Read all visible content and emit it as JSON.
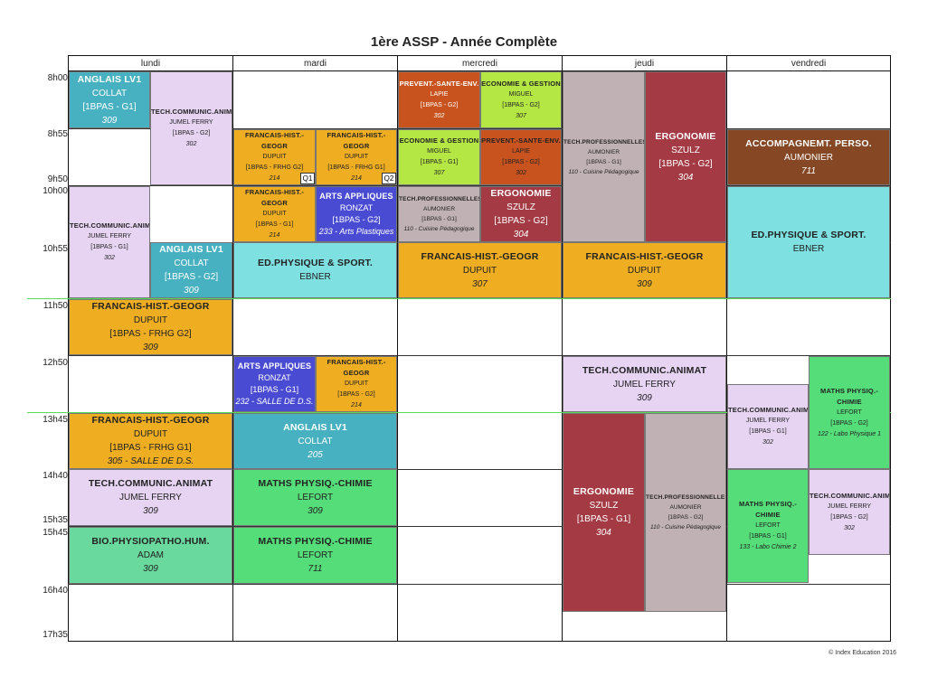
{
  "title": "1ère ASSP - Année Complète",
  "footer": "© Index Education 2016",
  "days": [
    "lundi",
    "mardi",
    "mercredi",
    "jeudi",
    "vendredi"
  ],
  "times": [
    "8h00",
    "8h55",
    "9h50",
    "10h00",
    "10h55",
    "11h50",
    "12h50",
    "13h45",
    "14h40",
    "15h35",
    "15h45",
    "16h40",
    "17h35"
  ],
  "colors": {
    "anglais": "#48b1c1",
    "tech": "#e6d4f2",
    "francais": "#efad21",
    "prevent": "#c9531e",
    "eco": "#b5e744",
    "techpro": "#c0b1b4",
    "ergo": "#a33a44",
    "arts": "#4a4bd3",
    "edphys": "#7ee0e0",
    "accomp": "#854724",
    "maths": "#55dd7a",
    "bio": "#6ad99e"
  },
  "cells": {
    "c1": {
      "subject": "ANGLAIS LV1",
      "teacher": "COLLAT",
      "group": "[1BPAS - G1]",
      "room": "309"
    },
    "c2": {
      "subject": "TECH.COMMUNIC.ANIMAT",
      "teacher": "JUMEL FERRY",
      "group": "[1BPAS - G2]",
      "room": "302"
    },
    "c3": {
      "subject": "TECH.COMMUNIC.ANIMAT",
      "teacher": "JUMEL FERRY",
      "group": "[1BPAS - G1]",
      "room": "302"
    },
    "c4": {
      "subject": "ANGLAIS LV1",
      "teacher": "COLLAT",
      "group": "[1BPAS - G2]",
      "room": "309"
    },
    "c5": {
      "subject": "FRANCAIS-HIST.-GEOGR",
      "teacher": "DUPUIT",
      "group": "[1BPAS - FRHG G2]",
      "room": "309"
    },
    "c6": {
      "subject": "FRANCAIS-HIST.-GEOGR",
      "teacher": "DUPUIT",
      "group": "[1BPAS - FRHG G1]",
      "room": "305 - SALLE DE D.S."
    },
    "c7": {
      "subject": "TECH.COMMUNIC.ANIMAT",
      "teacher": "JUMEL FERRY",
      "room": "309"
    },
    "c8": {
      "subject": "BIO.PHYSIOPATHO.HUM.",
      "teacher": "ADAM",
      "room": "309"
    },
    "c9": {
      "subject": "FRANCAIS-HIST.-GEOGR",
      "teacher": "DUPUIT",
      "group": "[1BPAS - FRHG G2]",
      "room": "214",
      "tag": "Q1"
    },
    "c10": {
      "subject": "FRANCAIS-HIST.-GEOGR",
      "teacher": "DUPUIT",
      "group": "[1BPAS - FRHG G1]",
      "room": "214",
      "tag": "Q2"
    },
    "c11": {
      "subject": "FRANCAIS-HIST.-GEOGR",
      "teacher": "DUPUIT",
      "group": "[1BPAS - G1]",
      "room": "214"
    },
    "c12": {
      "subject": "ARTS APPLIQUES",
      "teacher": "RONZAT",
      "group": "[1BPAS - G2]",
      "room": "233 - Arts Plastiques"
    },
    "c13": {
      "subject": "ED.PHYSIQUE & SPORT.",
      "teacher": "EBNER"
    },
    "c14": {
      "subject": "ARTS APPLIQUES",
      "teacher": "RONZAT",
      "group": "[1BPAS - G1]",
      "room": "232 - SALLE DE D.S."
    },
    "c15": {
      "subject": "FRANCAIS-HIST.-GEOGR",
      "teacher": "DUPUIT",
      "group": "[1BPAS - G2]",
      "room": "214"
    },
    "c16": {
      "subject": "ANGLAIS LV1",
      "teacher": "COLLAT",
      "room": "205"
    },
    "c17": {
      "subject": "MATHS PHYSIQ.-CHIMIE",
      "teacher": "LEFORT",
      "room": "309"
    },
    "c18": {
      "subject": "MATHS PHYSIQ.-CHIMIE",
      "teacher": "LEFORT",
      "room": "711"
    },
    "c19": {
      "subject": "PREVENT.-SANTE-ENV.",
      "teacher": "LAPIE",
      "group": "[1BPAS - G2]",
      "room": "302"
    },
    "c20": {
      "subject": "ECONOMIE & GESTION",
      "teacher": "MIGUEL",
      "group": "[1BPAS - G2]",
      "room": "307"
    },
    "c21": {
      "subject": "ECONOMIE & GESTION",
      "teacher": "MIGUEL",
      "group": "[1BPAS - G1]",
      "room": "307"
    },
    "c22": {
      "subject": "PREVENT.-SANTE-ENV.",
      "teacher": "LAPIE",
      "group": "[1BPAS - G2]",
      "room": "302"
    },
    "c23": {
      "subject": "TECH.PROFESSIONNELLES",
      "teacher": "AUMONIER",
      "group": "[1BPAS - G1]",
      "room": "110 - Cuisine Pédagogique"
    },
    "c24": {
      "subject": "ERGONOMIE",
      "teacher": "SZULZ",
      "group": "[1BPAS - G2]",
      "room": "304"
    },
    "c25": {
      "subject": "FRANCAIS-HIST.-GEOGR",
      "teacher": "DUPUIT",
      "room": "307"
    },
    "c26": {
      "subject": "TECH.PROFESSIONNELLES",
      "teacher": "AUMONIER",
      "group": "[1BPAS - G1]",
      "room": "110 - Cuisine Pédagogique"
    },
    "c27": {
      "subject": "ERGONOMIE",
      "teacher": "SZULZ",
      "group": "[1BPAS - G2]",
      "room": "304"
    },
    "c28": {
      "subject": "FRANCAIS-HIST.-GEOGR",
      "teacher": "DUPUIT",
      "room": "309"
    },
    "c29": {
      "subject": "TECH.COMMUNIC.ANIMAT",
      "teacher": "JUMEL FERRY",
      "room": "309"
    },
    "c30": {
      "subject": "ERGONOMIE",
      "teacher": "SZULZ",
      "group": "[1BPAS - G1]",
      "room": "304"
    },
    "c31": {
      "subject": "TECH.PROFESSIONNELLES",
      "teacher": "AUMONIER",
      "group": "[1BPAS - G2]",
      "room": "110 - Cuisine Pédagogique"
    },
    "c32": {
      "subject": "ACCOMPAGNEMT. PERSO.",
      "teacher": "AUMONIER",
      "room": "711"
    },
    "c33": {
      "subject": "ED.PHYSIQUE & SPORT.",
      "teacher": "EBNER"
    },
    "c34": {
      "subject": "TECH.COMMUNIC.ANIMAT",
      "teacher": "JUMEL FERRY",
      "group": "[1BPAS - G1]",
      "room": "302"
    },
    "c35": {
      "subject": "MATHS PHYSIQ.-CHIMIE",
      "teacher": "LEFORT",
      "group": "[1BPAS - G2]",
      "room": "122 - Labo Physique 1"
    },
    "c36": {
      "subject": "MATHS PHYSIQ.-CHIMIE",
      "teacher": "LEFORT",
      "group": "[1BPAS - G1]",
      "room": "133 - Labo Chimie 2"
    },
    "c37": {
      "subject": "TECH.COMMUNIC.ANIMAT",
      "teacher": "JUMEL FERRY",
      "group": "[1BPAS - G2]",
      "room": "302"
    }
  }
}
